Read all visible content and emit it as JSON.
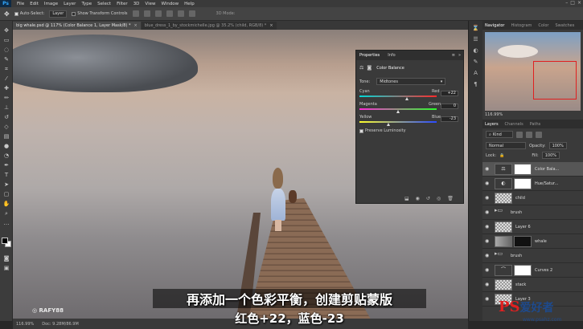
{
  "app": {
    "logo": "Ps"
  },
  "menu": [
    "File",
    "Edit",
    "Image",
    "Layer",
    "Type",
    "Select",
    "Filter",
    "3D",
    "View",
    "Window",
    "Help"
  ],
  "options": {
    "auto_select": "Auto-Select:",
    "auto_select_target": "Layer",
    "show_transform": "Show Transform Controls",
    "mode_3d": "3D Mode:"
  },
  "tabs": [
    {
      "label": "big whale.psd @ 117% (Color Balance 1, Layer Mask/8) *",
      "active": true
    },
    {
      "label": "blue_dress_1_by_stockmichelle.jpg @ 35.2% (child, RGB/8) *",
      "active": false
    }
  ],
  "properties": {
    "tabs": [
      "Properties",
      "Info"
    ],
    "title": "Color Balance",
    "tone_label": "Tone:",
    "tone_value": "Midtones",
    "sliders": [
      {
        "left": "Cyan",
        "right": "Red",
        "value": "+22",
        "pos": 0.61
      },
      {
        "left": "Magenta",
        "right": "Green",
        "value": "0",
        "pos": 0.5
      },
      {
        "left": "Yellow",
        "right": "Blue",
        "value": "-23",
        "pos": 0.38
      }
    ],
    "preserve": "Preserve Luminosity"
  },
  "navigator": {
    "tabs": [
      "Navigator",
      "Histogram",
      "Color",
      "Swatches"
    ],
    "zoom": "116.99%"
  },
  "layers": {
    "tabs": [
      "Layers",
      "Channels",
      "Paths"
    ],
    "kind": "Kind",
    "blend": "Normal",
    "opacity_label": "Opacity:",
    "opacity": "100%",
    "lock_label": "Lock:",
    "fill_label": "Fill:",
    "fill": "100%",
    "items": [
      {
        "name": "Color Bala...",
        "thumb": "adj",
        "selected": true
      },
      {
        "name": "Hue/Satur...",
        "thumb": "adj",
        "selected": false
      },
      {
        "name": "child",
        "thumb": "checker",
        "selected": false
      },
      {
        "name": "brush",
        "thumb": "folder",
        "selected": false
      },
      {
        "name": "Layer 6",
        "thumb": "checker",
        "selected": false
      },
      {
        "name": "whale",
        "thumb": "photo",
        "selected": false
      },
      {
        "name": "brush",
        "thumb": "folder",
        "selected": false
      },
      {
        "name": "Curves 2",
        "thumb": "adj",
        "selected": false
      },
      {
        "name": "stack",
        "thumb": "checker",
        "selected": false
      },
      {
        "name": "Layer 3",
        "thumb": "checker",
        "selected": false
      }
    ]
  },
  "status": {
    "zoom": "116.99%",
    "doc": "Doc: 9.28M/86.9M"
  },
  "watermark": "RAFY88",
  "subtitles": {
    "line1": "再添加一个色彩平衡，创建剪贴蒙版",
    "line2": "红色+22，蓝色-23"
  },
  "site_logo": {
    "ps": "PS",
    "text": "爱好者",
    "url": "www.psahz.com"
  }
}
